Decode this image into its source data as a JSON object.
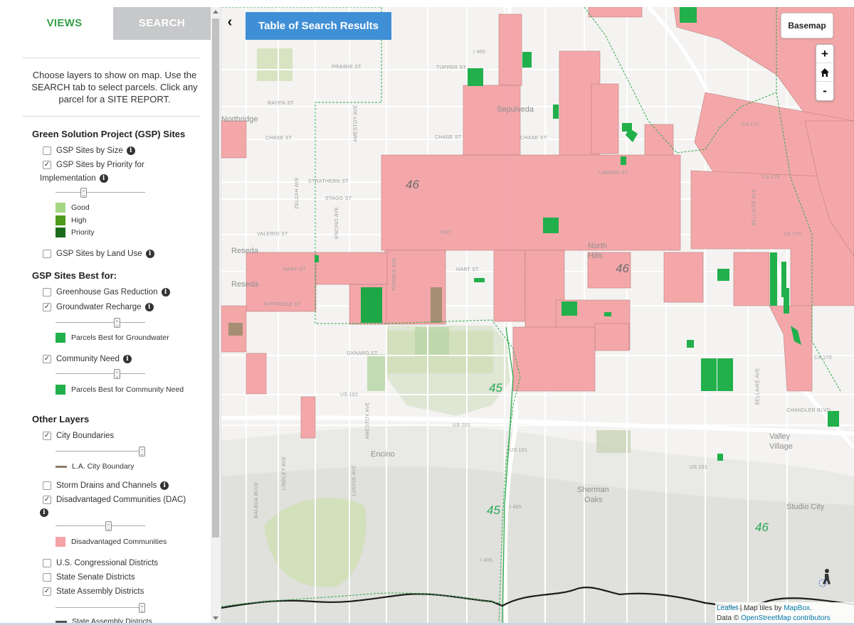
{
  "tabs": {
    "views": "VIEWS",
    "search": "SEARCH"
  },
  "intro": "Choose layers to show on map. Use the SEARCH tab to select parcels. Click any parcel for a SITE REPORT.",
  "gsp": {
    "title": "Green Solution Project (GSP) Sites",
    "by_size": "GSP Sites by Size",
    "by_priority_1": "GSP Sites by Priority for",
    "by_priority_2": "Implementation",
    "legend": [
      "Good",
      "High",
      "Priority"
    ],
    "by_land_use": "GSP Sites by Land Use",
    "priority_opacity": 0.3
  },
  "best_for": {
    "title": "GSP Sites Best for:",
    "ghg": "Greenhouse Gas Reduction",
    "groundwater": "Groundwater Recharge",
    "groundwater_legend": "Parcels Best for Groundwater",
    "groundwater_opacity": 0.7,
    "community": "Community Need",
    "community_legend": "Parcels Best for Community Need",
    "community_opacity": 0.7
  },
  "other": {
    "title": "Other Layers",
    "city": "City Boundaries",
    "city_legend": "L.A. City Boundary",
    "city_opacity": 1.0,
    "storm": "Storm Drains and Channels",
    "dac": "Disadvantaged Communities (DAC)",
    "dac_legend": "Disadvantaged Communities",
    "dac_opacity": 0.6,
    "congress": "U.S. Congressional Districts",
    "senate": "State Senate Districts",
    "assembly": "State Assembly Districts",
    "assembly_opacity": 1.0,
    "assembly_legend": "State Assembly Districts"
  },
  "colors": {
    "good": "#a6d785",
    "high": "#4f9a1c",
    "priority": "#1c6b1c",
    "parcel_green": "#21b04b",
    "dac_pink": "#f4a3a6",
    "city_line": "#8c7b6b",
    "accent_green": "#37a148",
    "button_blue": "#3f8fd6"
  },
  "map": {
    "table_button": "Table of Search Results",
    "basemap_button": "Basemap",
    "zoom_in": "+",
    "zoom_out": "-",
    "home_icon": "home-icon",
    "streets": {
      "prairie": "PRAIRIE ST",
      "tupper": "TUPPER ST",
      "rayen": "RAYEN ST",
      "chase1": "CHASE ST",
      "chase2": "CHASE ST",
      "chase3": "CHASE ST",
      "strathern": "STRATHERN ST",
      "stagg": "STAGG ST",
      "valerio": "VALERIO ST",
      "hart1": "HART ST",
      "hart2": "HART ST",
      "kittridge": "KITTRIDGE ST",
      "oxnard": "OXNARD ST",
      "lanark": "LANARK ST",
      "amestoy1": "AMESTOY AVE",
      "amestoy2": "AMESTOY AVE",
      "zelzah": "ZELZAH AVE",
      "encino_ave": "ENCINO AVE",
      "forbes": "FORBES AVE",
      "lindley": "LINDLEY AVE",
      "louise": "LOUISE AVE",
      "bellaire1": "BELLAIRE AVE",
      "bellaire2": "BELLAIRE AVE",
      "us101a": "US 101",
      "us101b": "US 101",
      "us101c": "US 101",
      "us101d": "US 101",
      "i405a": "I 405",
      "i405b": "I 405",
      "i405c": "I 405",
      "ca170a": "CA 170",
      "ca170b": "CA 170",
      "ca170c": "CA 170",
      "ca170d": "CA 170",
      "chandler": "CHANDLER BLVD",
      "vanny": "VNY",
      "balboa": "BALBOA BLVD"
    },
    "places": {
      "northridge": "Northridge",
      "sepulveda": "Sepulveda",
      "reseda1": "Reseda",
      "reseda2": "Reseda",
      "encino": "Encino",
      "sherman": "Sherman",
      "oaks": "Oaks",
      "valley": "Valley",
      "village": "Village",
      "studio": "Studio City",
      "north": "North",
      "hills": "Hills"
    },
    "districts": [
      "46",
      "46",
      "45",
      "45",
      "46"
    ]
  },
  "attribution": {
    "leaflet": "Leaflet",
    "tiles_by": " | Map tiles by ",
    "mapbox": "MapBox",
    "period": ".",
    "data": "Data © ",
    "osm": "OpenStreetMap contributors"
  }
}
